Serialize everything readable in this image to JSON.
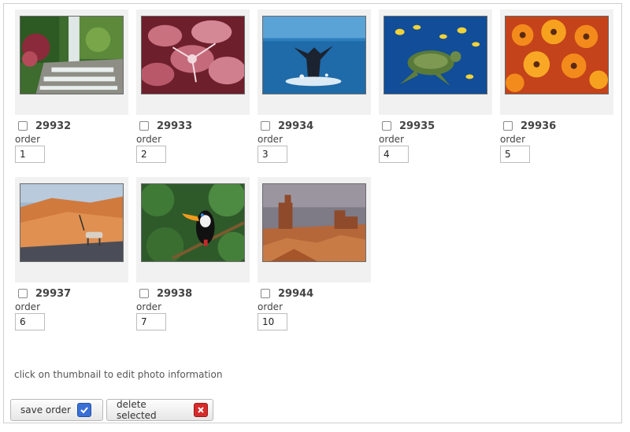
{
  "photos": [
    {
      "id": "29932",
      "order_label": "order",
      "order": "1",
      "thumb": "waterfall-garden"
    },
    {
      "id": "29933",
      "order_label": "order",
      "order": "2",
      "thumb": "frosted-leaves"
    },
    {
      "id": "29934",
      "order_label": "order",
      "order": "3",
      "thumb": "whale-tail"
    },
    {
      "id": "29935",
      "order_label": "order",
      "order": "4",
      "thumb": "sea-turtle"
    },
    {
      "id": "29936",
      "order_label": "order",
      "order": "5",
      "thumb": "orange-flowers"
    },
    {
      "id": "29937",
      "order_label": "order",
      "order": "6",
      "thumb": "desert-oryx"
    },
    {
      "id": "29938",
      "order_label": "order",
      "order": "7",
      "thumb": "toucan"
    },
    {
      "id": "29944",
      "order_label": "order",
      "order": "10",
      "thumb": "monument-valley"
    }
  ],
  "hint": "click on thumbnail to edit photo information",
  "buttons": {
    "save_order": "save order",
    "delete_selected": "delete selected"
  },
  "colors": {
    "save_icon": "#3a6fd6",
    "delete_icon": "#d62b2b",
    "card_bg": "#f1f1f1"
  }
}
